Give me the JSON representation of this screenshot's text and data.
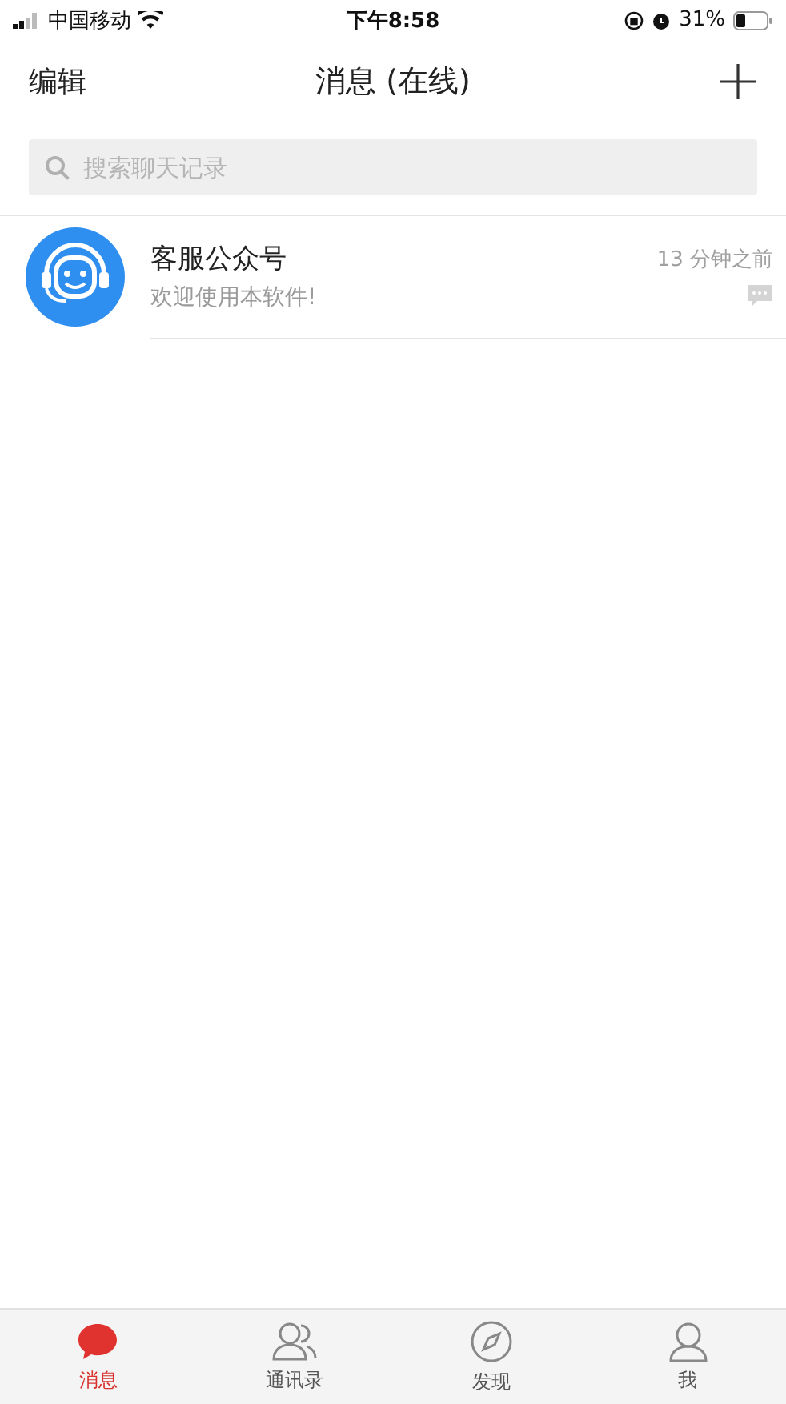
{
  "status_bar": {
    "carrier": "中国移动",
    "time": "下午8:58",
    "battery": "31%"
  },
  "nav_bar": {
    "left": "编辑",
    "title": "消息 (在线)"
  },
  "search": {
    "placeholder": "搜索聊天记录"
  },
  "conversations": [
    {
      "name": "客服公众号",
      "preview": "欢迎使用本软件!",
      "time": "13 分钟之前"
    }
  ],
  "tabs": [
    {
      "label": "消息",
      "kind": "chat",
      "selected": true
    },
    {
      "label": "通讯录",
      "kind": "contacts",
      "selected": false
    },
    {
      "label": "发现",
      "kind": "discover",
      "selected": false
    },
    {
      "label": "我",
      "kind": "me",
      "selected": false
    }
  ]
}
